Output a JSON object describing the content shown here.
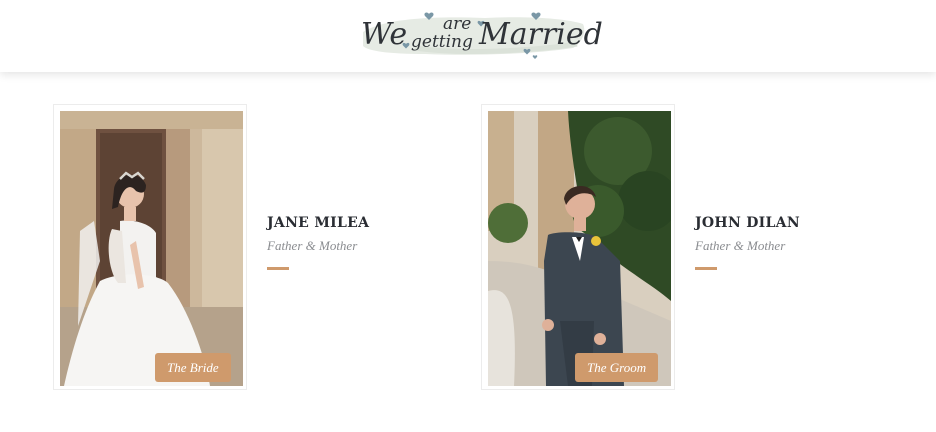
{
  "header": {
    "logo": {
      "word1": "We",
      "word2a": "are",
      "word2b": "getting",
      "word3": "Married"
    }
  },
  "couple": [
    {
      "name": "JANE MILEA",
      "parents": "Father & Mother",
      "role": "The Bride"
    },
    {
      "name": "JOHN DILAN",
      "parents": "Father & Mother",
      "role": "The Groom"
    }
  ],
  "colors": {
    "accent": "#cf9a6c",
    "heading": "#2a2d33",
    "muted": "#8a8c90"
  }
}
